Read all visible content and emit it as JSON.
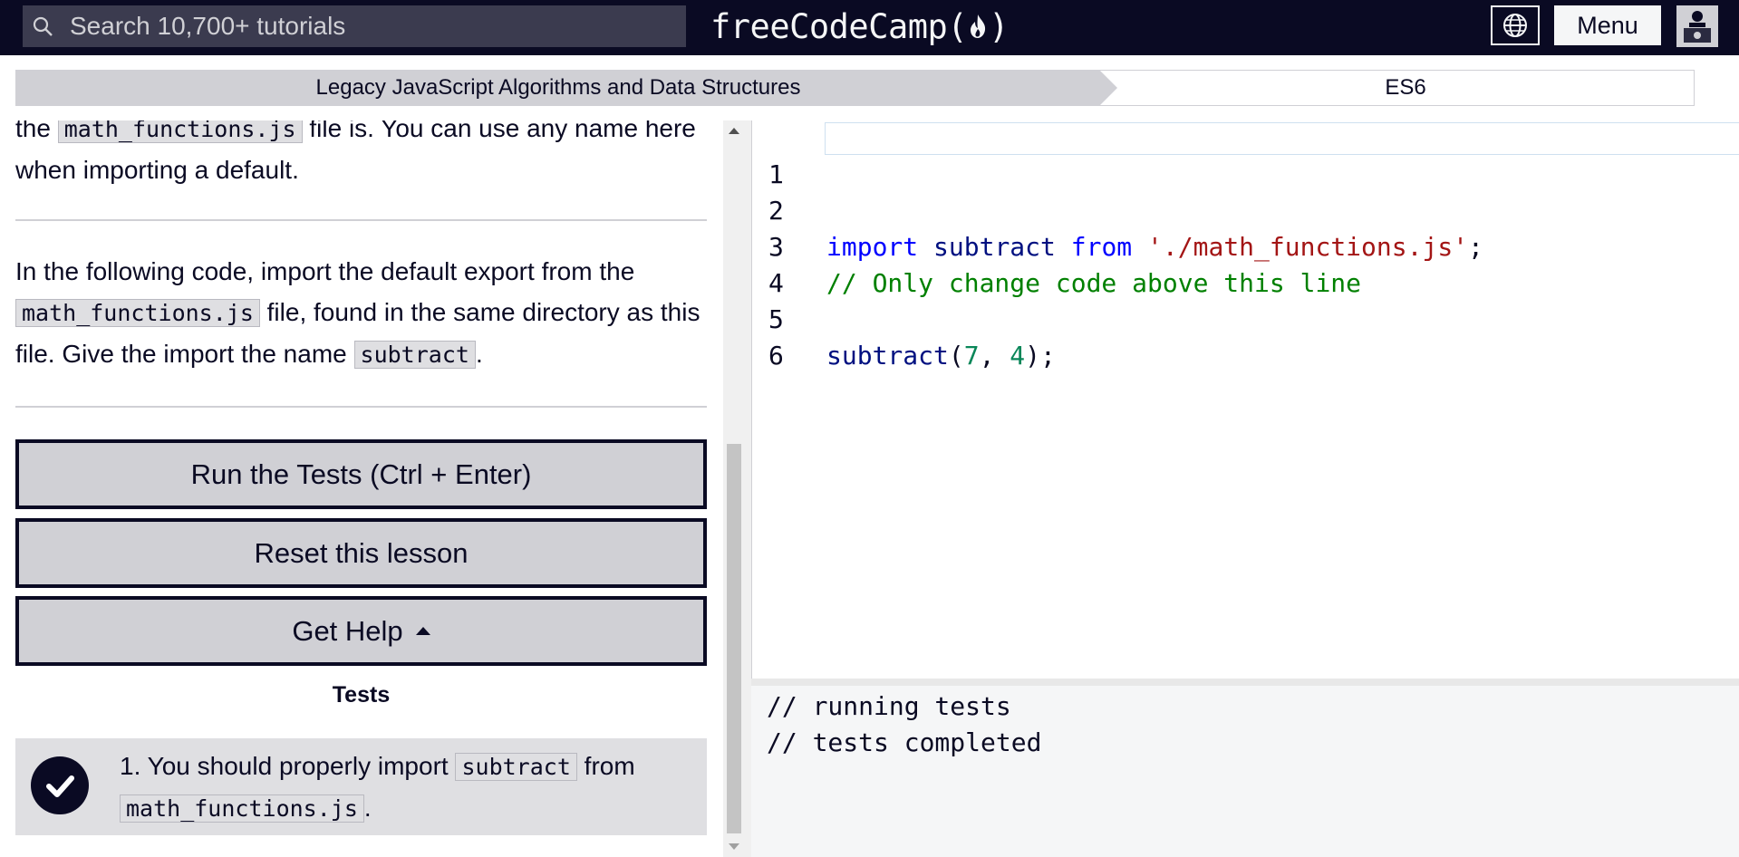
{
  "header": {
    "search_placeholder": "Search 10,700+ tutorials",
    "brand": "freeCodeCamp",
    "brand_paren_open": "(",
    "brand_paren_close": ")",
    "menu_label": "Menu",
    "icons": {
      "search": "search-icon",
      "language": "globe-icon",
      "flame": "flame-icon",
      "avatar": "user-avatar"
    },
    "colors": {
      "nav_bg": "#0a0a23",
      "nav_fg": "#f5f6f7"
    }
  },
  "breadcrumb": {
    "section": "Legacy JavaScript Algorithms and Data Structures",
    "subsection": "ES6"
  },
  "instructions": {
    "para1": {
      "pre": "the",
      "code": "math_functions.js",
      "post": "file is. You can use any name here when importing a default."
    },
    "para2": {
      "text1": "In the following code, import the default export from the",
      "code1": "math_functions.js",
      "text2": "file, found in the same directory as this file. Give the import the name",
      "code2": "subtract",
      "text3": "."
    }
  },
  "buttons": {
    "run_tests": "Run the Tests (Ctrl + Enter)",
    "reset": "Reset this lesson",
    "get_help": "Get Help"
  },
  "tests": {
    "title": "Tests",
    "items": [
      {
        "pre": "1. You should properly import",
        "code1": "subtract",
        "mid": "from",
        "code2": "math_functions.js",
        "post": ".",
        "passed": true
      }
    ]
  },
  "editor": {
    "line_numbers": [
      "1",
      "2",
      "3",
      "4",
      "5",
      "6"
    ],
    "line1": {
      "kw_import": "import",
      "ident": "subtract",
      "kw_from": "from",
      "string": "'./math_functions.js'",
      "semi": ";"
    },
    "line3": {
      "comment": "// Only change code above this line"
    },
    "line5": {
      "fn": "subtract",
      "open": "(",
      "arg1": "7",
      "sep": ", ",
      "arg2": "4",
      "close": ");"
    }
  },
  "console": {
    "lines": [
      "// running tests",
      "// tests completed"
    ]
  }
}
